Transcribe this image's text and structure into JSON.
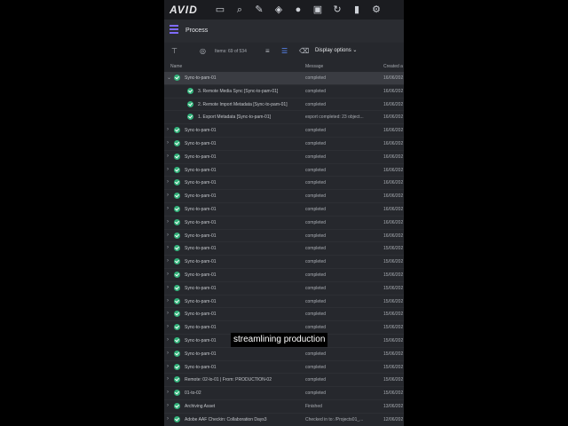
{
  "app": {
    "logo": "AVID",
    "panel_title": "Process",
    "items_count": "Items: 69 of 534",
    "display_options": "Display options"
  },
  "topbar_icons": [
    "folder-icon",
    "search-icon",
    "edit-icon",
    "layers-icon",
    "user-icon",
    "dashboard-icon",
    "refresh-icon",
    "bookmark-icon",
    "settings-icon"
  ],
  "columns": {
    "name": "Name",
    "message": "Message",
    "created": "Created a"
  },
  "rows": [
    {
      "name": "Sync-to-pam-01",
      "message": "completed",
      "date": "16/06/202",
      "indent": 0,
      "selected": true
    },
    {
      "name": "3. Remote Media Sync [Sync-to-pam-01]",
      "message": "completed",
      "date": "16/06/202",
      "indent": 1
    },
    {
      "name": "2. Remote Import Metadata [Sync-to-pam-01]",
      "message": "completed",
      "date": "16/06/202",
      "indent": 1
    },
    {
      "name": "1. Export Metadata [Sync-to-pam-01]",
      "message": "export completed: 23 object...",
      "date": "16/06/202",
      "indent": 1
    },
    {
      "name": "Sync-to-pam-01",
      "message": "completed",
      "date": "16/06/202",
      "indent": 0
    },
    {
      "name": "Sync-to-pam-01",
      "message": "completed",
      "date": "16/06/202",
      "indent": 0
    },
    {
      "name": "Sync-to-pam-01",
      "message": "completed",
      "date": "16/06/202",
      "indent": 0
    },
    {
      "name": "Sync-to-pam-01",
      "message": "completed",
      "date": "16/06/202",
      "indent": 0
    },
    {
      "name": "Sync-to-pam-01",
      "message": "completed",
      "date": "16/06/202",
      "indent": 0
    },
    {
      "name": "Sync-to-pam-01",
      "message": "completed",
      "date": "16/06/202",
      "indent": 0
    },
    {
      "name": "Sync-to-pam-01",
      "message": "completed",
      "date": "16/06/202",
      "indent": 0
    },
    {
      "name": "Sync-to-pam-01",
      "message": "completed",
      "date": "16/06/202",
      "indent": 0
    },
    {
      "name": "Sync-to-pam-01",
      "message": "completed",
      "date": "16/06/202",
      "indent": 0
    },
    {
      "name": "Sync-to-pam-01",
      "message": "completed",
      "date": "15/06/202",
      "indent": 0
    },
    {
      "name": "Sync-to-pam-01",
      "message": "completed",
      "date": "15/06/202",
      "indent": 0
    },
    {
      "name": "Sync-to-pam-01",
      "message": "completed",
      "date": "15/06/202",
      "indent": 0
    },
    {
      "name": "Sync-to-pam-01",
      "message": "completed",
      "date": "15/06/202",
      "indent": 0
    },
    {
      "name": "Sync-to-pam-01",
      "message": "completed",
      "date": "15/06/202",
      "indent": 0
    },
    {
      "name": "Sync-to-pam-01",
      "message": "completed",
      "date": "15/06/202",
      "indent": 0
    },
    {
      "name": "Sync-to-pam-01",
      "message": "completed",
      "date": "15/06/202",
      "indent": 0
    },
    {
      "name": "Sync-to-pam-01",
      "message": "completed",
      "date": "15/06/202",
      "indent": 0
    },
    {
      "name": "Sync-to-pam-01",
      "message": "completed",
      "date": "15/06/202",
      "indent": 0
    },
    {
      "name": "Sync-to-pam-01",
      "message": "completed",
      "date": "15/06/202",
      "indent": 0
    },
    {
      "name": "Remote: 02-lo-01 | From: PRODUCTION-02",
      "message": "completed",
      "date": "15/06/202",
      "indent": 0
    },
    {
      "name": "01-to-02",
      "message": "completed",
      "date": "15/06/202",
      "indent": 0
    },
    {
      "name": "Archiving Asset",
      "message": "Finished",
      "date": "13/06/202",
      "indent": 0
    },
    {
      "name": "Adobe AAF Checkin: Collaboration Days3",
      "message": "Checked in to: /Projects01_...",
      "date": "12/06/202",
      "indent": 0
    }
  ],
  "caption": "streamlining production"
}
